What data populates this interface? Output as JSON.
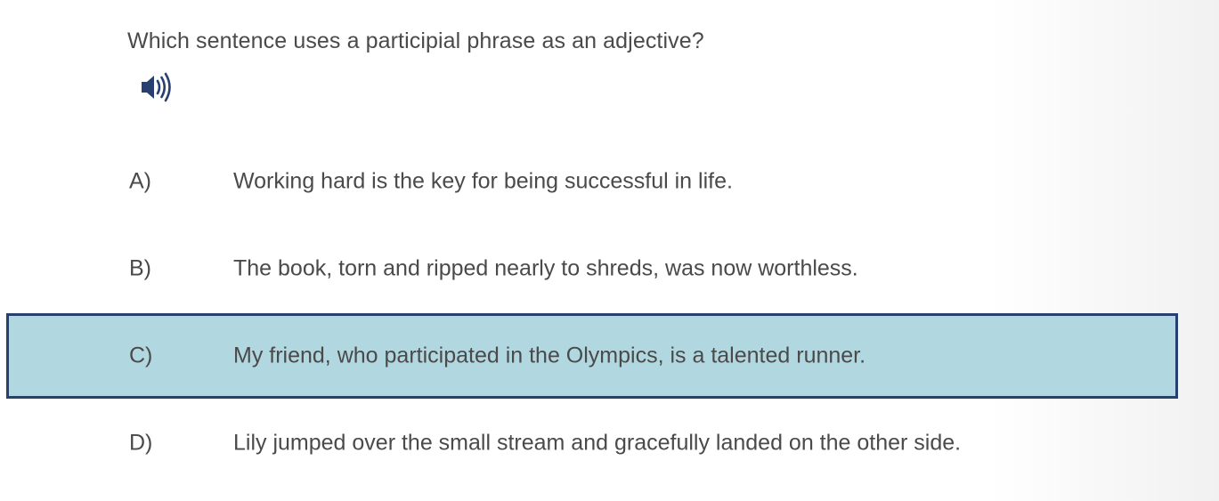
{
  "question": {
    "text": "Which sentence uses a participial phrase as an adjective?",
    "audio_icon": "speaker-icon"
  },
  "options": [
    {
      "letter": "A)",
      "text": "Working hard is the key for being successful in life.",
      "selected": false
    },
    {
      "letter": "B)",
      "text": "The book, torn and ripped nearly to shreds, was now worthless.",
      "selected": false
    },
    {
      "letter": "C)",
      "text": "My friend, who participated in the Olympics, is a talented runner.",
      "selected": true
    },
    {
      "letter": "D)",
      "text": "Lily jumped over the small stream and gracefully landed on the other side.",
      "selected": false
    }
  ],
  "colors": {
    "selected_fill": "#b1d8e0",
    "selected_border": "#27406f",
    "icon": "#27406f",
    "text": "#4a4a4a"
  }
}
